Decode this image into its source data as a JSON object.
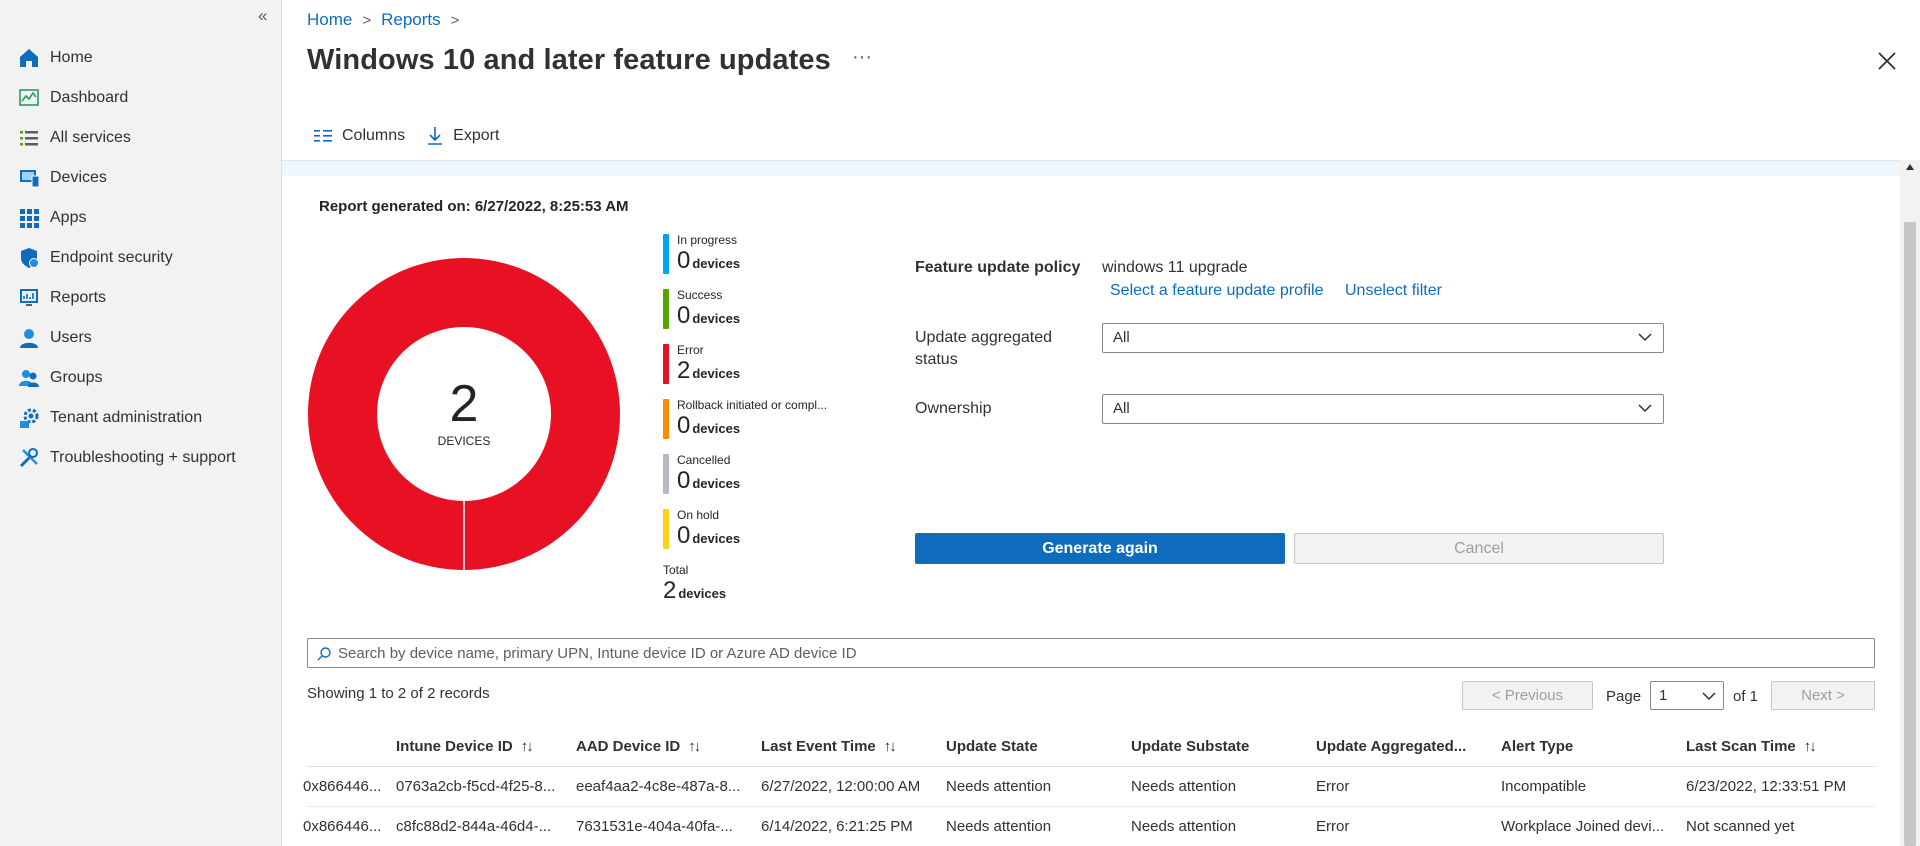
{
  "sidebar": {
    "items": [
      {
        "label": "Home",
        "icon": "home-icon"
      },
      {
        "label": "Dashboard",
        "icon": "dashboard-icon"
      },
      {
        "label": "All services",
        "icon": "list-icon"
      },
      {
        "label": "Devices",
        "icon": "devices-icon"
      },
      {
        "label": "Apps",
        "icon": "apps-grid-icon"
      },
      {
        "label": "Endpoint security",
        "icon": "shield-icon"
      },
      {
        "label": "Reports",
        "icon": "reports-icon"
      },
      {
        "label": "Users",
        "icon": "user-icon"
      },
      {
        "label": "Groups",
        "icon": "groups-icon"
      },
      {
        "label": "Tenant administration",
        "icon": "gear-icon"
      },
      {
        "label": "Troubleshooting + support",
        "icon": "wrench-icon"
      }
    ],
    "collapse_glyph": "«"
  },
  "breadcrumb": {
    "home": "Home",
    "reports": "Reports"
  },
  "page_title": "Windows 10 and later feature updates",
  "more_glyph": "···",
  "toolbar": {
    "columns_label": "Columns",
    "export_label": "Export"
  },
  "report_generated": "Report generated on: 6/27/2022, 8:25:53 AM",
  "donut": {
    "count": "2",
    "label": "DEVICES"
  },
  "legend": [
    {
      "name": "In progress",
      "value": "0",
      "unit": "devices",
      "color": "#00a4ef"
    },
    {
      "name": "Success",
      "value": "0",
      "unit": "devices",
      "color": "#57a300"
    },
    {
      "name": "Error",
      "value": "2",
      "unit": "devices",
      "color": "#e81123"
    },
    {
      "name": "Rollback initiated or compl...",
      "value": "0",
      "unit": "devices",
      "color": "#ff8c00"
    },
    {
      "name": "Cancelled",
      "value": "0",
      "unit": "devices",
      "color": "#b4b9c4"
    },
    {
      "name": "On hold",
      "value": "0",
      "unit": "devices",
      "color": "#fcd116"
    }
  ],
  "legend_total": {
    "name": "Total",
    "value": "2",
    "unit": "devices"
  },
  "chart_data": {
    "type": "pie",
    "categories": [
      "In progress",
      "Success",
      "Error",
      "Rollback initiated or compl...",
      "Cancelled",
      "On hold"
    ],
    "values": [
      0,
      0,
      2,
      0,
      0,
      0
    ],
    "colors": [
      "#00a4ef",
      "#57a300",
      "#e81123",
      "#ff8c00",
      "#b4b9c4",
      "#fcd116"
    ],
    "total": 2,
    "center_label": "DEVICES",
    "legend_placement": "right",
    "title": ""
  },
  "filters": {
    "policy_label": "Feature update policy",
    "policy_value": "windows 11 upgrade",
    "select_profile_link": "Select a feature update profile",
    "unselect_link": "Unselect filter",
    "status_label_line1": "Update aggregated",
    "status_label_line2": "status",
    "status_value": "All",
    "ownership_label": "Ownership",
    "ownership_value": "All"
  },
  "buttons": {
    "generate": "Generate again",
    "cancel": "Cancel"
  },
  "search": {
    "placeholder": "Search by device name, primary UPN, Intune device ID or Azure AD device ID"
  },
  "showing": "Showing 1 to 2 of 2 records",
  "pager": {
    "previous": "< Previous",
    "page_label": "Page",
    "page_value": "1",
    "of_label": "of 1",
    "next": "Next >"
  },
  "table": {
    "headers": [
      "Intune Device ID",
      "AAD Device ID",
      "Last Event Time",
      "Update State",
      "Update Substate",
      "Update Aggregated...",
      "Alert Type",
      "Last Scan Time"
    ],
    "sort_glyph": "↑↓",
    "rows": [
      [
        "0x866446...",
        "0763a2cb-f5cd-4f25-8...",
        "eeaf4aa2-4c8e-487a-8...",
        "6/27/2022, 12:00:00 AM",
        "Needs attention",
        "Needs attention",
        "Error",
        "Incompatible",
        "6/23/2022, 12:33:51 PM"
      ],
      [
        "0x866446...",
        "c8fc88d2-844a-46d4-...",
        "7631531e-404a-40fa-...",
        "6/14/2022, 6:21:25 PM",
        "Needs attention",
        "Needs attention",
        "Error",
        "Workplace Joined devi...",
        "Not scanned yet"
      ]
    ]
  }
}
